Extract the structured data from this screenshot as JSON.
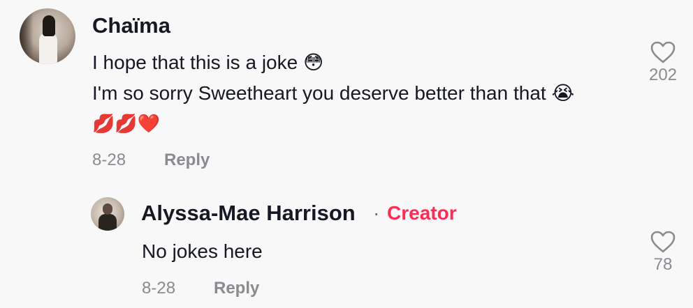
{
  "comment": {
    "username": "Chaïma",
    "text_line_1": "I hope that this is a joke 😳",
    "text_line_2": "I'm so sorry Sweetheart you deserve better than that 😭",
    "text_line_3": "💋💋❤️",
    "date": "8-28",
    "reply_label": "Reply",
    "like_count": "202",
    "like_icon": "heart-outline-icon"
  },
  "reply": {
    "username": "Alyssa-Mae Harrison",
    "separator": "·",
    "creator_label": "Creator",
    "text": "No jokes here",
    "date": "8-28",
    "reply_label": "Reply",
    "like_count": "78",
    "like_icon": "heart-outline-icon"
  },
  "colors": {
    "background": "#f8f8f8",
    "text": "#161823",
    "muted": "#8a8b91",
    "creator_accent": "#fe2c55"
  }
}
